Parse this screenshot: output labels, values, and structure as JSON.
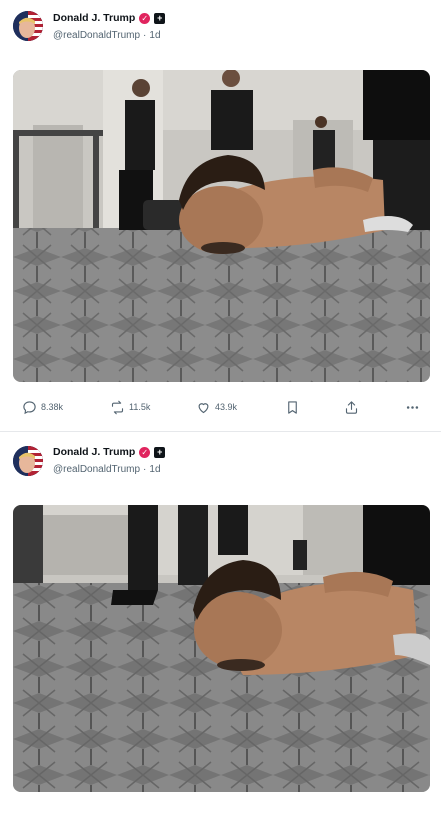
{
  "posts": [
    {
      "author": {
        "name": "Donald J. Trump",
        "handle": "@realDonaldTrump",
        "separator": "·",
        "time": "1d"
      },
      "actions": {
        "replies": "8.38k",
        "reposts": "11.5k",
        "likes": "43.9k"
      },
      "icons": [
        "comment-icon",
        "repost-icon",
        "heart-icon",
        "bookmark-icon",
        "share-icon",
        "more-icon"
      ]
    },
    {
      "author": {
        "name": "Donald J. Trump",
        "handle": "@realDonaldTrump",
        "separator": "·",
        "time": "1d"
      }
    }
  ],
  "colors": {
    "verified": "#e0245e",
    "muted": "#536471",
    "text": "#0f1419"
  }
}
